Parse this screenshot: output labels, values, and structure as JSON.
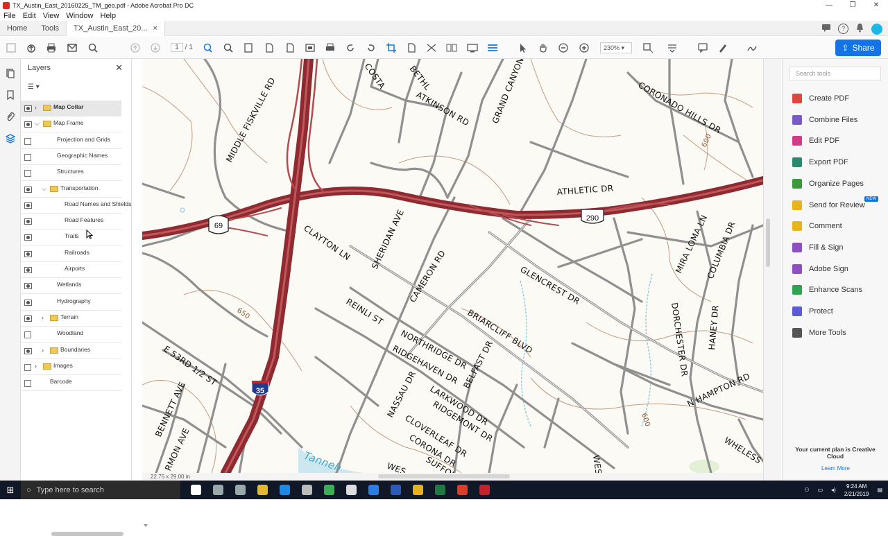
{
  "window": {
    "title": "TX_Austin_East_20160225_TM_geo.pdf - Adobe Acrobat Pro DC",
    "controls": [
      "—",
      "❐",
      "✕"
    ]
  },
  "menu": [
    "File",
    "Edit",
    "View",
    "Window",
    "Help"
  ],
  "tabs": {
    "home": "Home",
    "tools": "Tools",
    "doc": "TX_Austin_East_20...",
    "doc_close": "×"
  },
  "toolbar": {
    "page_current": "1",
    "page_total": "/ 1",
    "zoom": "230%",
    "share": "Share"
  },
  "layers_panel": {
    "title": "Layers",
    "close": "✕",
    "items": [
      {
        "label": "Map Collar",
        "vis": "eye",
        "twisty": "›",
        "folder": true,
        "indent": 0,
        "selected": true,
        "bold": true
      },
      {
        "label": "Map Frame",
        "vis": "eye",
        "twisty": "⌄",
        "folder": true,
        "indent": 0
      },
      {
        "label": "Projection and Grids",
        "vis": "box",
        "indent": 1
      },
      {
        "label": "Geographic Names",
        "vis": "box",
        "indent": 1
      },
      {
        "label": "Structures",
        "vis": "box",
        "indent": 1
      },
      {
        "label": "Transportation",
        "vis": "eye",
        "twisty": "⌄",
        "folder": true,
        "indent": 1
      },
      {
        "label": "Road Names and Shields",
        "vis": "eye",
        "indent": 2
      },
      {
        "label": "Road Features",
        "vis": "eye",
        "indent": 2
      },
      {
        "label": "Trails",
        "vis": "eye",
        "indent": 2
      },
      {
        "label": "Railroads",
        "vis": "eye",
        "indent": 2
      },
      {
        "label": "Airports",
        "vis": "eye",
        "indent": 2
      },
      {
        "label": "Wetlands",
        "vis": "eye",
        "indent": 1
      },
      {
        "label": "Hydrography",
        "vis": "eye",
        "indent": 1
      },
      {
        "label": "Terrain",
        "vis": "eye",
        "twisty": "›",
        "folder": true,
        "indent": 1
      },
      {
        "label": "Woodland",
        "vis": "box",
        "indent": 1
      },
      {
        "label": "Boundaries",
        "vis": "eye",
        "twisty": "›",
        "folder": true,
        "indent": 1
      },
      {
        "label": "Images",
        "vis": "box",
        "twisty": "›",
        "folder": true,
        "indent": 0
      },
      {
        "label": "Barcode",
        "vis": "box",
        "indent": 0
      }
    ]
  },
  "map": {
    "page_size": "22.75 x 29.00 in",
    "labels": {
      "middle_fiskville": "MIDDLE FISKVILLE RD",
      "costa": "COSTA",
      "bethl": "BETHL",
      "atkinson": "ATKINSON RD",
      "grand_canyon": "GRAND CANYON",
      "coronado": "CORONADO HILLS DR",
      "c600a": "600",
      "athletic": "ATHLETIC DR",
      "shield_290": "290",
      "shield_69": "69",
      "clayton": "CLAYTON LN",
      "sheridan": "SHERIDAN AVE",
      "cameron": "CAMERON RD",
      "glencrest": "GLENCREST DR",
      "mira_loma": "MIRA LOMA LN",
      "columbia": "COLUMBIA DR",
      "reinli": "REINLI ST",
      "briarcliff": "BRIARCLIFF BLVD",
      "northridge": "NORTHRIDGE DR",
      "ridgehaven": "RIDGEHAVEN DR",
      "belfast": "BELFAST DR",
      "c650": "650",
      "e53": "E 53RD 1/2 ST",
      "shield_35": "35",
      "dorchester": "DORCHESTER DR",
      "haney": "HANEY DR",
      "n_hampton": "N HAMPTON RD",
      "nassau": "NASSAU DR",
      "larkwood": "LARKWOOD DR",
      "ridgemont": "RIDGEMONT DR",
      "cloverleaf": "CLOVERLEAF DR",
      "corona": "CORONA DR",
      "suffolk": "SUFFOLK",
      "bennett": "BENNETT AVE",
      "armon": "RMON AVE",
      "tannehill": "Tanneh",
      "wes1": "WES",
      "wes2": "WES",
      "whele": "WHELESS",
      "c600b": "600"
    }
  },
  "tools_panel": {
    "search_placeholder": "Search tools",
    "items": [
      {
        "label": "Create PDF",
        "color": "#e0463d"
      },
      {
        "label": "Combine Files",
        "color": "#7a5ac8"
      },
      {
        "label": "Edit PDF",
        "color": "#d13b8a"
      },
      {
        "label": "Export PDF",
        "color": "#2b8a6e"
      },
      {
        "label": "Organize Pages",
        "color": "#3a9a3a"
      },
      {
        "label": "Send for Review",
        "color": "#e9b31c"
      },
      {
        "label": "Comment",
        "color": "#e9b31c"
      },
      {
        "label": "Fill & Sign",
        "color": "#8e4fc2"
      },
      {
        "label": "Adobe Sign",
        "color": "#8e4fc2"
      },
      {
        "label": "Enhance Scans",
        "color": "#2fa552"
      },
      {
        "label": "Protect",
        "color": "#5b5bd6"
      },
      {
        "label": "More Tools",
        "color": "#555555"
      }
    ],
    "new_badge": "NEW",
    "plan_text": "Your current plan is Creative Cloud",
    "learn_more": "Learn More"
  },
  "taskbar": {
    "search_placeholder": "Type here to search",
    "time": "9:24 AM",
    "date": "2/21/2019",
    "icons": [
      {
        "name": "task-view-icon",
        "color": "#ffffff"
      },
      {
        "name": "sync-icon",
        "color": "#9aa"
      },
      {
        "name": "globe-icon",
        "color": "#9aa"
      },
      {
        "name": "chrome-icon",
        "color": "#e5b731"
      },
      {
        "name": "edge-icon",
        "color": "#1e88e5"
      },
      {
        "name": "calculator-icon",
        "color": "#bbb"
      },
      {
        "name": "drive-icon",
        "color": "#3cae56"
      },
      {
        "name": "mail-icon",
        "color": "#ddd"
      },
      {
        "name": "dropbox-icon",
        "color": "#2b7de2"
      },
      {
        "name": "word-icon",
        "color": "#2b5cb8"
      },
      {
        "name": "photos-icon",
        "color": "#e6b21f"
      },
      {
        "name": "excel-icon",
        "color": "#1f7a3f"
      },
      {
        "name": "red-app-icon",
        "color": "#e03a28"
      },
      {
        "name": "acrobat-icon",
        "color": "#c3222a"
      }
    ]
  },
  "colors": {
    "highway": "#a8323a",
    "road": "#8a8a8a",
    "contour": "#b07a5a",
    "water": "#7fc7e0",
    "accent": "#1473e6"
  }
}
